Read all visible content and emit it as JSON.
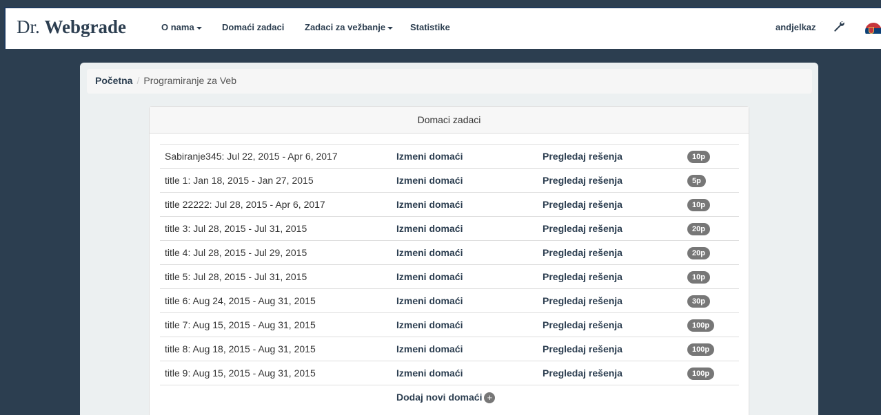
{
  "brand": {
    "part1": "Dr.",
    "part2": "Webgrade"
  },
  "nav": {
    "about": "O nama",
    "homework": "Domaći zadaci",
    "exercises": "Zadaci za vežbanje",
    "stats": "Statistike",
    "user": "andjelkaz"
  },
  "breadcrumb": {
    "home": "Početna",
    "separator": "/",
    "current": "Programiranje za Veb"
  },
  "panel": {
    "heading": "Domaci zadaci"
  },
  "homeworks": [
    {
      "title": "Sabiranje345: Jul 22, 2015 - Apr 6, 2017",
      "edit": "Izmeni domaći",
      "view": "Pregledaj rešenja",
      "points": "10p"
    },
    {
      "title": "title 1: Jan 18, 2015 - Jan 27, 2015",
      "edit": "Izmeni domaći",
      "view": "Pregledaj rešenja",
      "points": "5p"
    },
    {
      "title": "title 22222: Jul 28, 2015 - Apr 6, 2017",
      "edit": "Izmeni domaći",
      "view": "Pregledaj rešenja",
      "points": "10p"
    },
    {
      "title": "title 3: Jul 28, 2015 - Jul 31, 2015",
      "edit": "Izmeni domaći",
      "view": "Pregledaj rešenja",
      "points": "20p"
    },
    {
      "title": "title 4: Jul 28, 2015 - Jul 29, 2015",
      "edit": "Izmeni domaći",
      "view": "Pregledaj rešenja",
      "points": "20p"
    },
    {
      "title": "title 5: Jul 28, 2015 - Jul 31, 2015",
      "edit": "Izmeni domaći",
      "view": "Pregledaj rešenja",
      "points": "10p"
    },
    {
      "title": "title 6: Aug 24, 2015 - Aug 31, 2015",
      "edit": "Izmeni domaći",
      "view": "Pregledaj rešenja",
      "points": "30p"
    },
    {
      "title": "title 7: Aug 15, 2015 - Aug 31, 2015",
      "edit": "Izmeni domaći",
      "view": "Pregledaj rešenja",
      "points": "100p"
    },
    {
      "title": "title 8: Aug 18, 2015 - Aug 31, 2015",
      "edit": "Izmeni domaći",
      "view": "Pregledaj rešenja",
      "points": "100p"
    },
    {
      "title": "title 9: Aug 15, 2015 - Aug 31, 2015",
      "edit": "Izmeni domaći",
      "view": "Pregledaj rešenja",
      "points": "100p"
    }
  ],
  "add": {
    "label": "Dodaj novi domaći",
    "icon": "+"
  },
  "icons": {
    "settings": "wrench-icon",
    "language": "serbian-flag-icon"
  },
  "colors": {
    "background": "#2c3e50",
    "badge": "#777777",
    "link": "#2c3e50"
  }
}
